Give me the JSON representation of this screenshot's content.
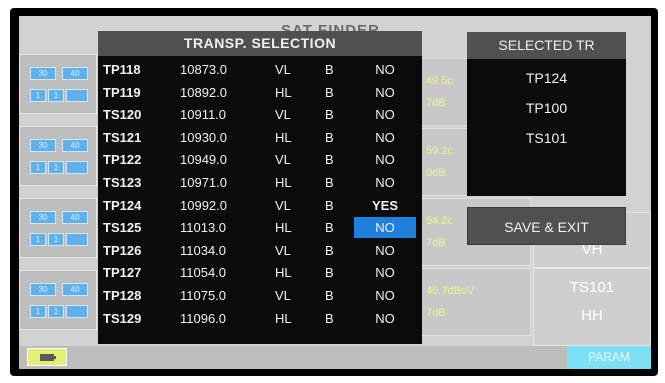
{
  "background": {
    "title": "SAT FINDER",
    "range_buttons": [
      "30",
      "40"
    ],
    "step_buttons": [
      "1",
      "1"
    ],
    "readings": [
      {
        "level": "49.5c",
        "quality": "7dB"
      },
      {
        "level": "59.2c",
        "quality": "0dB"
      },
      {
        "level": "54.2c",
        "quality": "7dB"
      },
      {
        "level": "46.7dBuV",
        "quality": "7dB"
      }
    ],
    "right_tiles": [
      {
        "line1": "",
        "line2": ""
      },
      {
        "line1": "",
        "line2": ""
      },
      {
        "line1": "",
        "line2": "VH"
      },
      {
        "line1": "TS101",
        "line2": "HH"
      }
    ],
    "param_label": "PARAM"
  },
  "transponder_panel": {
    "title": "TRANSP. SELECTION",
    "rows": [
      {
        "id": "TP118",
        "freq": "10873.0",
        "pol": "VL",
        "band": "B",
        "selected": "NO"
      },
      {
        "id": "TP119",
        "freq": "10892.0",
        "pol": "HL",
        "band": "B",
        "selected": "NO"
      },
      {
        "id": "TS120",
        "freq": "10911.0",
        "pol": "VL",
        "band": "B",
        "selected": "NO"
      },
      {
        "id": "TS121",
        "freq": "10930.0",
        "pol": "HL",
        "band": "B",
        "selected": "NO"
      },
      {
        "id": "TP122",
        "freq": "10949.0",
        "pol": "VL",
        "band": "B",
        "selected": "NO"
      },
      {
        "id": "TS123",
        "freq": "10971.0",
        "pol": "HL",
        "band": "B",
        "selected": "NO"
      },
      {
        "id": "TP124",
        "freq": "10992.0",
        "pol": "VL",
        "band": "B",
        "selected": "YES"
      },
      {
        "id": "TS125",
        "freq": "11013.0",
        "pol": "HL",
        "band": "B",
        "selected": "NO"
      },
      {
        "id": "TP126",
        "freq": "11034.0",
        "pol": "VL",
        "band": "B",
        "selected": "NO"
      },
      {
        "id": "TP127",
        "freq": "11054.0",
        "pol": "HL",
        "band": "B",
        "selected": "NO"
      },
      {
        "id": "TP128",
        "freq": "11075.0",
        "pol": "VL",
        "band": "B",
        "selected": "NO"
      },
      {
        "id": "TS129",
        "freq": "11096.0",
        "pol": "HL",
        "band": "B",
        "selected": "NO"
      }
    ],
    "highlighted_row": 7
  },
  "selected_panel": {
    "title": "SELECTED TR",
    "items": [
      "TP124",
      "TP100",
      "TS101"
    ]
  },
  "save_exit_label": "SAVE & EXIT",
  "colors": {
    "highlight": "#1e80dc",
    "panel_header": "#505050",
    "panel_body": "#0b0b0b"
  }
}
